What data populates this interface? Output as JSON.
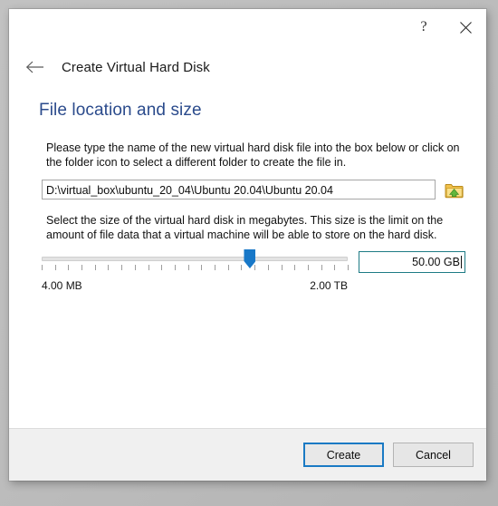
{
  "window": {
    "caption": {
      "help_icon": "question-mark-icon",
      "close_icon": "close-icon",
      "help_label": "?"
    },
    "back_icon": "back-arrow-icon",
    "wizard_title": "Create Virtual Hard Disk"
  },
  "page": {
    "heading": "File location and size",
    "paragraph_1": "Please type the name of the new virtual hard disk file into the box below or click on the folder icon to select a different folder to create the file in.",
    "paragraph_2": "Select the size of the virtual hard disk in megabytes. This size is the limit on the amount of file data that a virtual machine will be able to store on the hard disk."
  },
  "path": {
    "value": "D:\\virtual_box\\ubuntu_20_04\\Ubuntu 20.04\\Ubuntu 20.04",
    "placeholder": "",
    "browse_icon": "folder-open-icon"
  },
  "size": {
    "slider_min_label": "4.00 MB",
    "slider_max_label": "2.00 TB",
    "slider_percent": 68,
    "tick_count": 24,
    "value": "50.00 GB"
  },
  "footer": {
    "create_label": "Create",
    "cancel_label": "Cancel"
  },
  "colors": {
    "heading": "#2b4b8c",
    "accent": "#1878c8",
    "focus_border": "#1a7ac4",
    "field_focus": "#1e7b85"
  }
}
